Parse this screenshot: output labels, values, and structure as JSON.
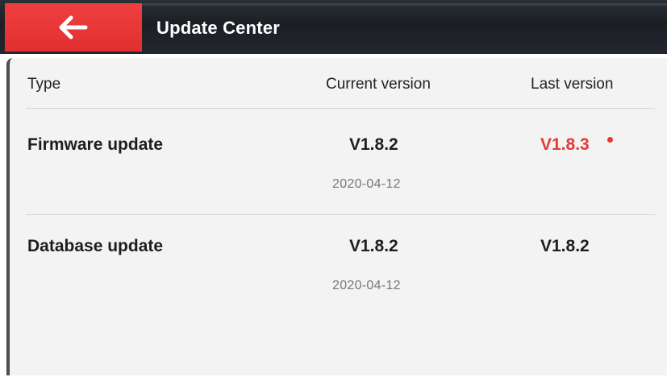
{
  "header": {
    "title": "Update Center",
    "back_icon": "arrow-left-icon"
  },
  "table": {
    "columns": {
      "type": "Type",
      "current": "Current version",
      "last": "Last version"
    },
    "rows": [
      {
        "name": "Firmware update",
        "current_version": "V1.8.2",
        "date": "2020-04-12",
        "last_version": "V1.8.3",
        "has_update": true
      },
      {
        "name": "Database update",
        "current_version": "V1.8.2",
        "date": "2020-04-12",
        "last_version": "V1.8.2",
        "has_update": false
      }
    ]
  },
  "colors": {
    "accent": "#e53935",
    "header_bg": "#1b1f24",
    "panel_bg": "#f3f3f3"
  }
}
